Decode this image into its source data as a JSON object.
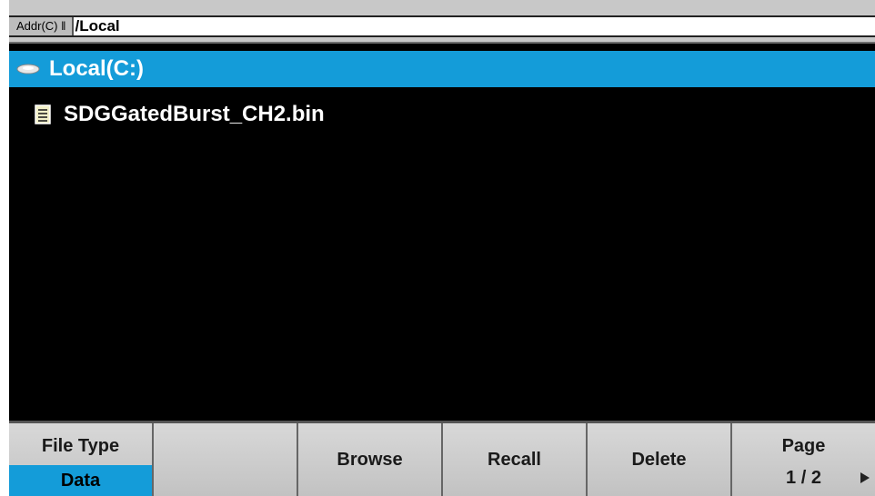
{
  "address_bar": {
    "label": "Addr(C)",
    "separator": "‖",
    "path": "/Local"
  },
  "file_list": {
    "selected_drive": "Local(C:)",
    "files": [
      {
        "name": "SDGGatedBurst_CH2.bin",
        "icon": "file-icon"
      }
    ]
  },
  "softkeys": {
    "file_type": {
      "label": "File Type",
      "value": "Data"
    },
    "empty": "",
    "browse": "Browse",
    "recall": "Recall",
    "delete": "Delete",
    "page": {
      "label": "Page",
      "value": "1 / 2"
    }
  },
  "colors": {
    "highlight": "#149cd9",
    "background": "#000000",
    "softkey": "#cfcfcf"
  }
}
